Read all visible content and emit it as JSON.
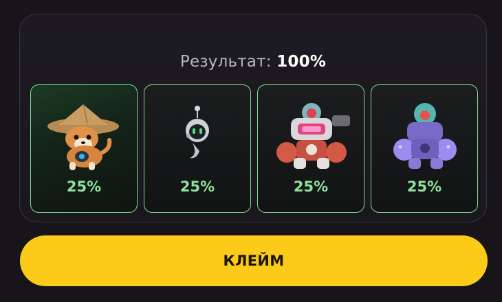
{
  "result": {
    "label": "Результат:",
    "value": "100%"
  },
  "cards": [
    {
      "name": "shiba-warrior",
      "percent": "25%",
      "icon": "dog-icon"
    },
    {
      "name": "robot-drone",
      "percent": "25%",
      "icon": "robot-icon"
    },
    {
      "name": "red-mech",
      "percent": "25%",
      "icon": "mech-icon"
    },
    {
      "name": "purple-mech",
      "percent": "25%",
      "icon": "mech-icon"
    }
  ],
  "claim_button": {
    "label": "КЛЕЙМ"
  },
  "colors": {
    "accent": "#fcca18",
    "percent_green": "#8ee39c",
    "card_border": "#7ee089"
  }
}
